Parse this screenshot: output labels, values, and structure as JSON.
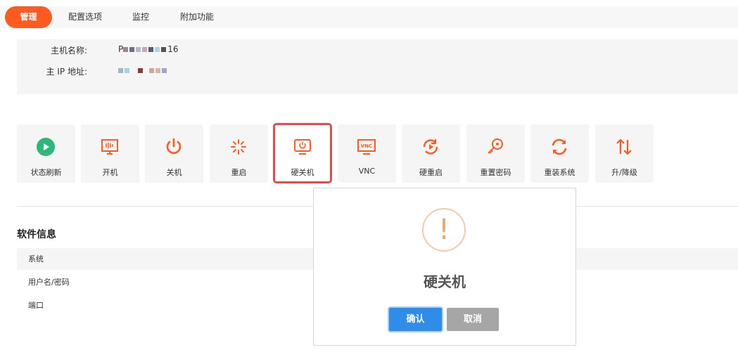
{
  "tabs": [
    "管理",
    "配置选项",
    "监控",
    "附加功能"
  ],
  "info": {
    "hostname_label": "主机名称:",
    "hostname_prefix": "P",
    "hostname_suffix": "16",
    "ip_label": "主 IP 地址:"
  },
  "actions": [
    {
      "label": "状态刷新",
      "icon": "play-circle-icon",
      "color": "#2fb77a"
    },
    {
      "label": "开机",
      "icon": "power-on-monitor-icon",
      "color": "#ff5a1f"
    },
    {
      "label": "关机",
      "icon": "power-icon",
      "color": "#ff5a1f"
    },
    {
      "label": "重启",
      "icon": "loading-spinner-icon",
      "color": "#ff5a1f"
    },
    {
      "label": "硬关机",
      "icon": "monitor-power-icon",
      "color": "#ff5a1f"
    },
    {
      "label": "VNC",
      "icon": "vnc-icon",
      "color": "#ff5a1f"
    },
    {
      "label": "硬重启",
      "icon": "hard-restart-icon",
      "color": "#ff5a1f"
    },
    {
      "label": "重置密码",
      "icon": "key-icon",
      "color": "#ff5a1f"
    },
    {
      "label": "重装系统",
      "icon": "reinstall-icon",
      "color": "#ff5a1f"
    },
    {
      "label": "升/降级",
      "icon": "up-down-arrows-icon",
      "color": "#ff5a1f"
    }
  ],
  "software": {
    "title": "软件信息",
    "rows": [
      "系统",
      "用户名/密码",
      "端口"
    ]
  },
  "dialog": {
    "icon": "!",
    "title": "硬关机",
    "confirm": "确认",
    "cancel": "取消"
  }
}
